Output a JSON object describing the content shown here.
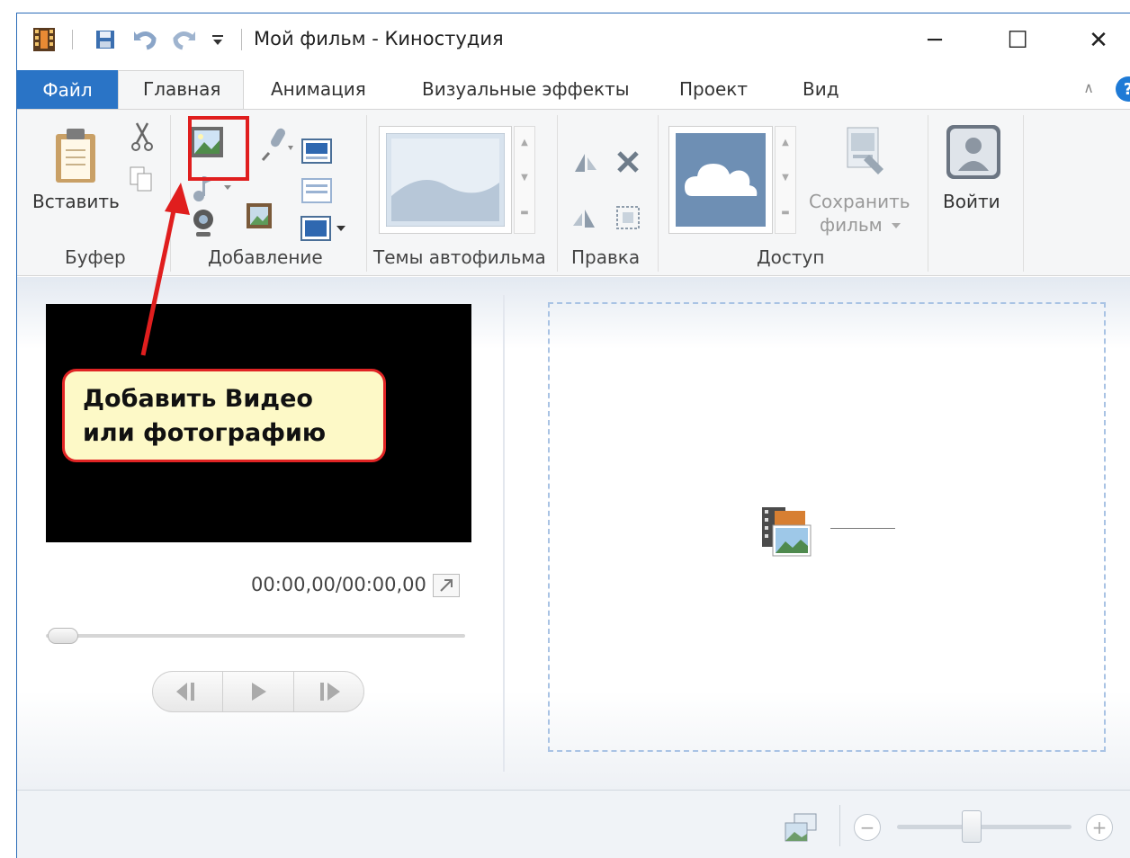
{
  "window": {
    "title": "Мой фильм - Киностудия",
    "minimize": "─",
    "maximize": "☐",
    "close": "✕"
  },
  "quick_access": {
    "icons": [
      "film-app-icon",
      "save-icon",
      "undo-icon",
      "redo-icon",
      "customize-dropdown-icon"
    ]
  },
  "tabs": {
    "file": "Файл",
    "items": [
      "Главная",
      "Анимация",
      "Визуальные эффекты",
      "Проект",
      "Вид"
    ],
    "active": "Главная",
    "help": "?"
  },
  "ribbon": {
    "paste_label": "Вставить",
    "save_movie_label_1": "Сохранить",
    "save_movie_label_2": "фильм",
    "sign_in_label": "Войти",
    "groups": [
      "Буфер",
      "Добавление",
      "Темы автофильма",
      "Правка",
      "Доступ"
    ]
  },
  "player": {
    "timecode": "00:00,00/00:00,00",
    "seek_position": 0
  },
  "annotation": {
    "line1": "Добавить Видео",
    "line2": "или фотографию"
  },
  "colors": {
    "accent": "#2a74c6",
    "callout_border": "#e02424",
    "callout_fill": "#fdf9c7",
    "storyboard_border": "#a9c3e4"
  }
}
